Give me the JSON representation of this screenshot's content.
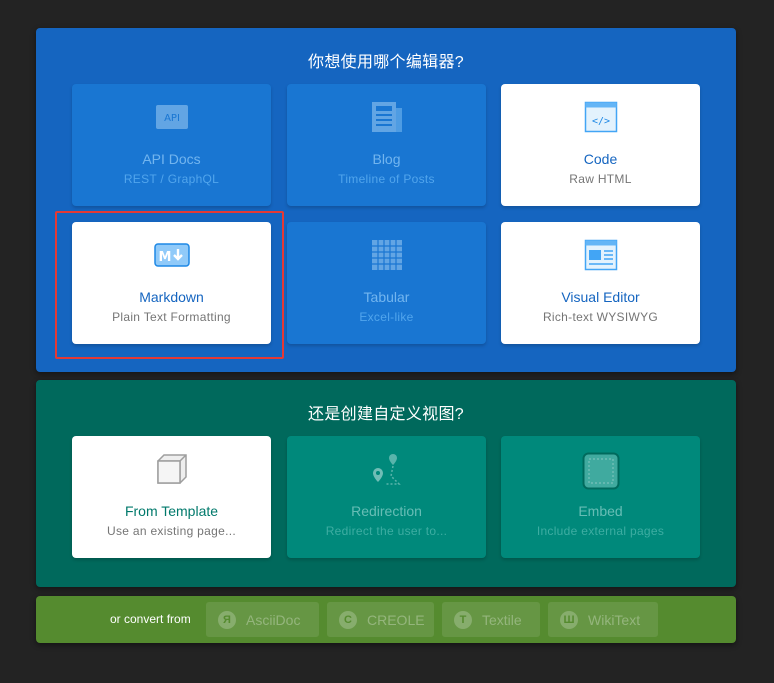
{
  "editor_section": {
    "title": "你想使用哪个编辑器?",
    "cards": [
      {
        "id": "api-docs",
        "title": "API Docs",
        "subtitle": "REST / GraphQL",
        "icon": "api-icon",
        "icon_text": "API"
      },
      {
        "id": "blog",
        "title": "Blog",
        "subtitle": "Timeline of Posts",
        "icon": "newspaper-icon"
      },
      {
        "id": "code",
        "title": "Code",
        "subtitle": "Raw HTML",
        "icon": "code-window-icon",
        "icon_text": "</>"
      },
      {
        "id": "markdown",
        "title": "Markdown",
        "subtitle": "Plain Text Formatting",
        "icon": "markdown-icon",
        "icon_text": "M"
      },
      {
        "id": "tabular",
        "title": "Tabular",
        "subtitle": "Excel-like",
        "icon": "table-grid-icon"
      },
      {
        "id": "visual-editor",
        "title": "Visual Editor",
        "subtitle": "Rich-text WYSIWYG",
        "icon": "visual-editor-icon"
      }
    ]
  },
  "custom_section": {
    "title": "还是创建自定义视图?",
    "cards": [
      {
        "id": "from-template",
        "title": "From Template",
        "subtitle": "Use an existing page...",
        "icon": "cube-icon"
      },
      {
        "id": "redirection",
        "title": "Redirection",
        "subtitle": "Redirect the user to...",
        "icon": "map-route-icon"
      },
      {
        "id": "embed",
        "title": "Embed",
        "subtitle": "Include external pages",
        "icon": "embed-frame-icon"
      }
    ]
  },
  "convert_bar": {
    "label": "or convert from",
    "options": [
      {
        "badge": "Я",
        "label": "AsciiDoc"
      },
      {
        "badge": "C",
        "label": "CREOLE"
      },
      {
        "badge": "T",
        "label": "Textile"
      },
      {
        "badge": "Ш",
        "label": "WikiText"
      }
    ]
  },
  "colors": {
    "editor_panel": "#1565c0",
    "custom_panel": "#00695c",
    "convert_panel": "#558b2f",
    "highlight": "#e53935"
  }
}
